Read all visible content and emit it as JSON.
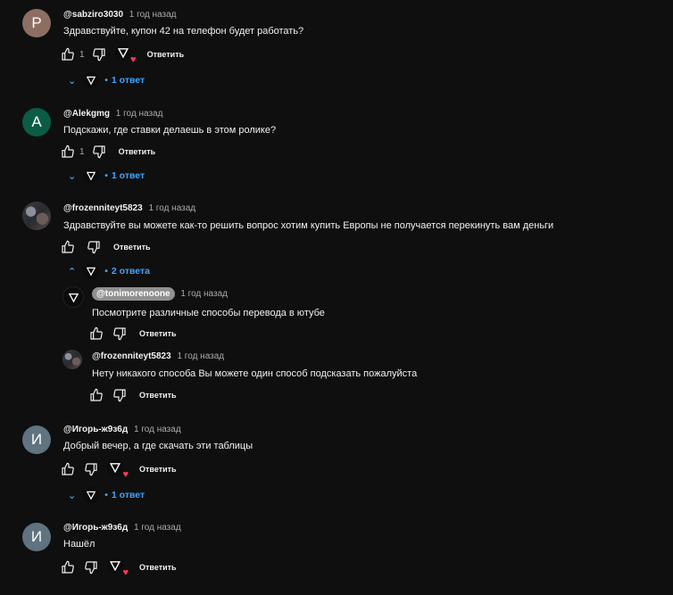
{
  "ui": {
    "reply_label": "Ответить",
    "dot": "•"
  },
  "comments": [
    {
      "author": "@sabziro3030",
      "time": "1 год назад",
      "text": "Здравствуйте, купон 42 на телефон будет работать?",
      "likes": "1",
      "avatar_letter": "P",
      "avatar_color": "#8d6e63",
      "replies": "1 ответ"
    },
    {
      "author": "@Alekgmg",
      "time": "1 год назад",
      "text": "Подскажи, где ставки делаешь в этом ролике?",
      "likes": "1",
      "avatar_letter": "A",
      "avatar_color": "#0b5c47",
      "replies": "1 ответ"
    },
    {
      "author": "@frozenniteyt5823",
      "time": "1 год назад",
      "text": "Здравствуйте вы можете как-то решить вопрос хотим купить Европы не получается перекинуть вам деньги",
      "likes": "",
      "replies": "2 ответа",
      "thread": [
        {
          "author": "@tonimorenoone",
          "time": "1 год назад",
          "text": "Посмотрите различные способы перевода в ютубе"
        },
        {
          "author": "@frozenniteyt5823",
          "time": "1 год назад",
          "text": "Нету никакого способа Вы можете один способ подсказать пожалуйста"
        }
      ]
    },
    {
      "author": "@Игорь-ж9з6д",
      "time": "1 год назад",
      "text": "Добрый вечер, а где скачать эти таблицы",
      "likes": "",
      "avatar_letter": "И",
      "avatar_color": "#5f7380",
      "replies": "1 ответ"
    },
    {
      "author": "@Игорь-ж9з6д",
      "time": "1 год назад",
      "text": "Нашёл",
      "likes": "",
      "avatar_letter": "И",
      "avatar_color": "#5f7380"
    }
  ]
}
